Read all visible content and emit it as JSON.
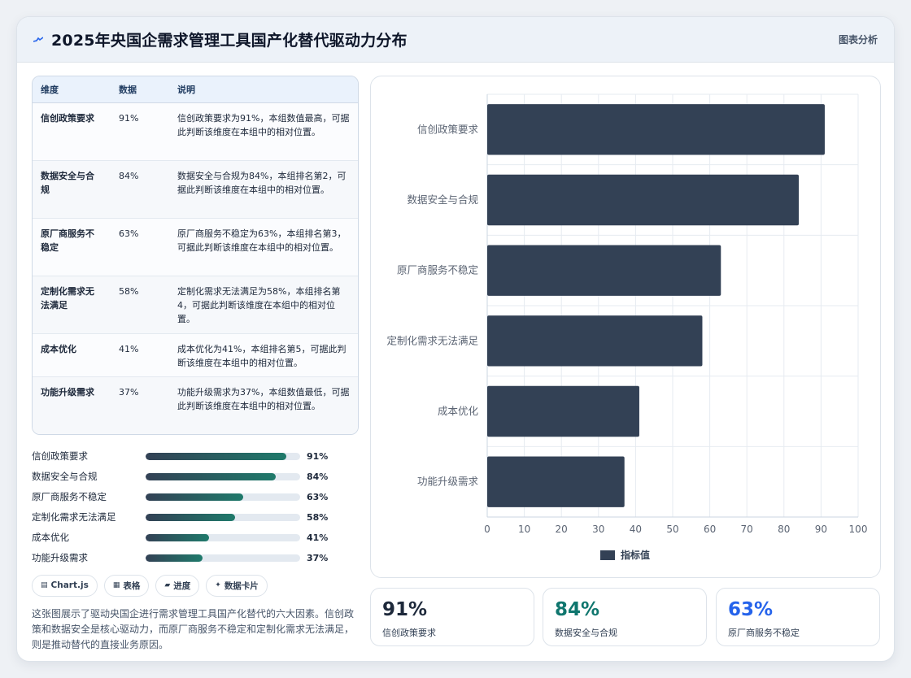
{
  "header": {
    "title": "2025年央国企需求管理工具国产化替代驱动力分布",
    "badge": "图表分析",
    "icon": "pulse-icon"
  },
  "table": {
    "columns": [
      "维度",
      "数据",
      "说明"
    ],
    "rows": [
      {
        "dim": "信创政策要求",
        "val": "91%",
        "note": "信创政策要求为91%，本组数值最高，可据此判断该维度在本组中的相对位置。"
      },
      {
        "dim": "数据安全与合规",
        "val": "84%",
        "note": "数据安全与合规为84%，本组排名第2，可据此判断该维度在本组中的相对位置。"
      },
      {
        "dim": "原厂商服务不稳定",
        "val": "63%",
        "note": "原厂商服务不稳定为63%，本组排名第3，可据此判断该维度在本组中的相对位置。"
      },
      {
        "dim": "定制化需求无法满足",
        "val": "58%",
        "note": "定制化需求无法满足为58%，本组排名第4，可据此判断该维度在本组中的相对位置。"
      },
      {
        "dim": "成本优化",
        "val": "41%",
        "note": "成本优化为41%，本组排名第5，可据此判断该维度在本组中的相对位置。"
      },
      {
        "dim": "功能升级需求",
        "val": "37%",
        "note": "功能升级需求为37%，本组数值最低，可据此判断该维度在本组中的相对位置。"
      }
    ]
  },
  "progress": [
    {
      "label": "信创政策要求",
      "value": 91,
      "text": "91%"
    },
    {
      "label": "数据安全与合规",
      "value": 84,
      "text": "84%"
    },
    {
      "label": "原厂商服务不稳定",
      "value": 63,
      "text": "63%"
    },
    {
      "label": "定制化需求无法满足",
      "value": 58,
      "text": "58%"
    },
    {
      "label": "成本优化",
      "value": 41,
      "text": "41%"
    },
    {
      "label": "功能升级需求",
      "value": 37,
      "text": "37%"
    }
  ],
  "chips": [
    {
      "icon": "▤",
      "label": "Chart.js"
    },
    {
      "icon": "▦",
      "label": "表格"
    },
    {
      "icon": "▰",
      "label": "进度"
    },
    {
      "icon": "✦",
      "label": "数据卡片"
    }
  ],
  "description": "这张图展示了驱动央国企进行需求管理工具国产化替代的六大因素。信创政策和数据安全是核心驱动力，而原厂商服务不稳定和定制化需求无法满足，则是推动替代的直接业务原因。",
  "stats": [
    {
      "value": "91%",
      "label": "信创政策要求",
      "color": "#1e293b"
    },
    {
      "value": "84%",
      "label": "数据安全与合规",
      "color": "#0f766e"
    },
    {
      "value": "63%",
      "label": "原厂商服务不稳定",
      "color": "#2563eb"
    }
  ],
  "colors": {
    "bar": "#334155",
    "progress_start": "#334155",
    "progress_end": "#1f7a6b"
  },
  "chart_data": {
    "type": "bar",
    "orientation": "horizontal",
    "categories": [
      "信创政策要求",
      "数据安全与合规",
      "原厂商服务不稳定",
      "定制化需求无法满足",
      "成本优化",
      "功能升级需求"
    ],
    "series": [
      {
        "name": "指标值",
        "values": [
          91,
          84,
          63,
          58,
          41,
          37
        ]
      }
    ],
    "xlim": [
      0,
      100
    ],
    "xticks": [
      0,
      10,
      20,
      30,
      40,
      50,
      60,
      70,
      80,
      90,
      100
    ],
    "grid": true,
    "legend": "bottom"
  }
}
